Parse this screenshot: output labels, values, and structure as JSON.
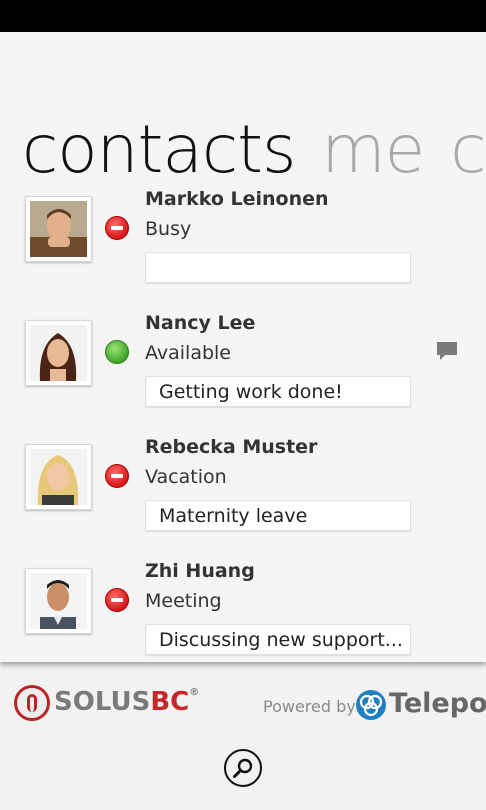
{
  "pivot": {
    "active": "contacts",
    "others": [
      "me",
      "ch"
    ]
  },
  "contacts": [
    {
      "name": "Markko Leinonen",
      "status": "Busy",
      "note": "",
      "presence": "busy",
      "has_chat": false
    },
    {
      "name": "Nancy Lee",
      "status": "Available",
      "note": "Getting work done!",
      "presence": "available",
      "has_chat": true
    },
    {
      "name": "Rebecka Muster",
      "status": "Vacation",
      "note": "Maternity leave",
      "presence": "busy",
      "has_chat": false
    },
    {
      "name": "Zhi Huang",
      "status": "Meeting",
      "note": "Discussing new support...",
      "presence": "busy",
      "has_chat": false
    }
  ],
  "footer": {
    "left_logo": {
      "part1": "SOLUS",
      "part2": "BC",
      "reg": "®"
    },
    "powered_by": "Powered by",
    "right_logo": {
      "text": "Telepo",
      "reg": "®"
    }
  },
  "colors": {
    "busy": "#d81818",
    "available": "#3fa526",
    "brand_red": "#c6262c",
    "telepo_blue": "#1f7fc1"
  },
  "icons": {
    "search": "search-icon",
    "chat": "chat-bubble-icon"
  }
}
